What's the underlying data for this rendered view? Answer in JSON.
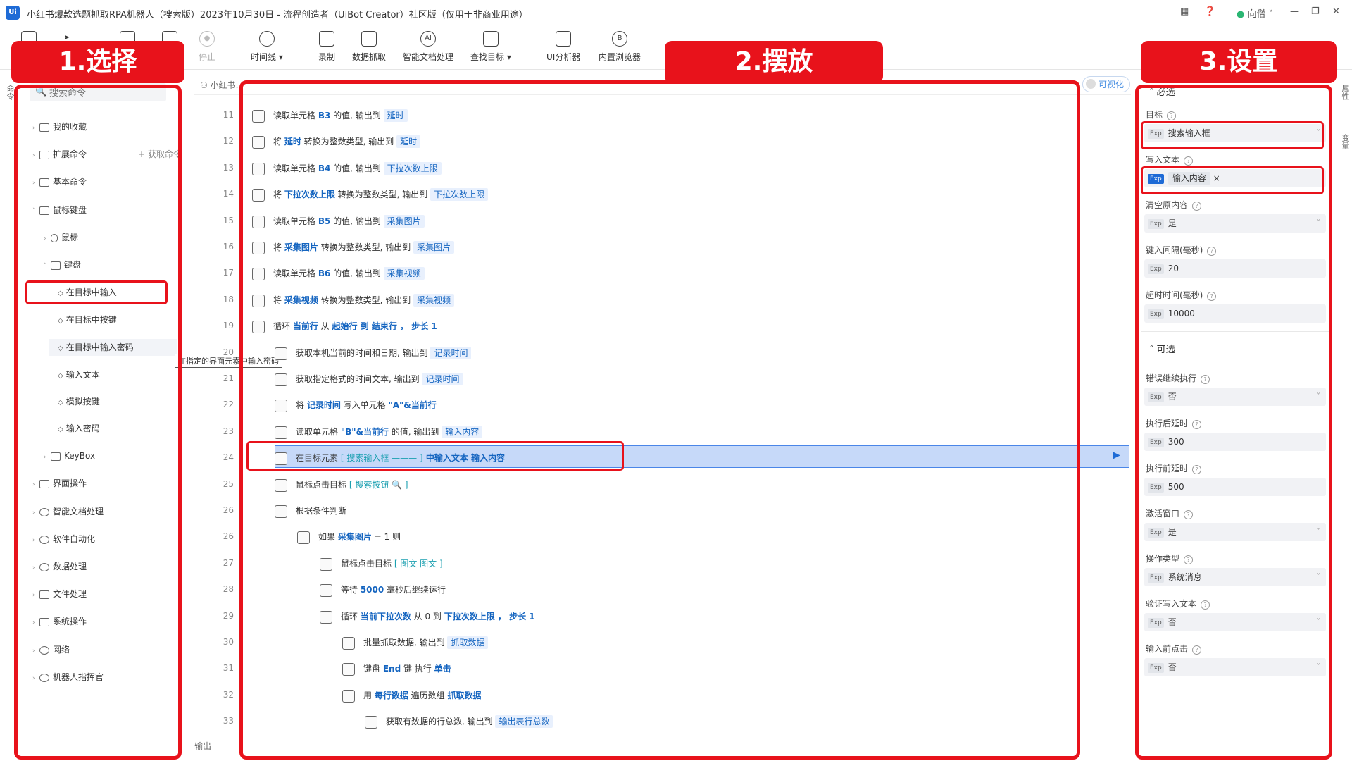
{
  "window": {
    "logo": "Ui",
    "title": "小红书爆款选题抓取RPA机器人（搜索版）2023年10月30日 - 流程创造者（UiBot Creator）社区版（仅用于非商业用途）",
    "user": "向僧"
  },
  "toolbar": {
    "items": [
      "停止",
      "时间线",
      "录制",
      "数据抓取",
      "智能文档处理",
      "查找目标",
      "UI分析器",
      "内置浏览器"
    ]
  },
  "annotations": {
    "select": "1.选择",
    "place": "2.摆放",
    "settings": "3.设置"
  },
  "left_panel": {
    "search_placeholder": "搜索命令",
    "add_command": "+ 获取命令",
    "tree": [
      "我的收藏",
      "扩展命令",
      "基本命令",
      "鼠标键盘",
      "鼠标",
      "键盘",
      "在目标中输入",
      "在目标中按键",
      "在目标中输入密码",
      "输入文本",
      "模拟按键",
      "输入密码",
      "KeyBox",
      "界面操作",
      "智能文档处理",
      "软件自动化",
      "数据处理",
      "文件处理",
      "系统操作",
      "网络",
      "机器人指挥官"
    ],
    "tooltip": "在指定的界面元素中输入密码"
  },
  "editor": {
    "tab": "小红书...",
    "viz_toggle": "可视化",
    "output": "输出",
    "line_numbers": [
      "11",
      "12",
      "13",
      "14",
      "15",
      "16",
      "17",
      "18",
      "19",
      "20",
      "21",
      "22",
      "23",
      "24",
      "25",
      "26",
      "26",
      "27",
      "28",
      "29",
      "30",
      "31",
      "32",
      "33"
    ],
    "rows": [
      {
        "p1": "读取单元格 ",
        "k1": "B3",
        "p2": " 的值, 输出到 ",
        "t1": "延时"
      },
      {
        "p1": "将 ",
        "k1": "延时",
        "p2": " 转换为整数类型, 输出到 ",
        "t1": "延时"
      },
      {
        "p1": "读取单元格 ",
        "k1": "B4",
        "p2": " 的值, 输出到 ",
        "t1": "下拉次数上限"
      },
      {
        "p1": "将 ",
        "k1": "下拉次数上限",
        "p2": " 转换为整数类型, 输出到 ",
        "t1": "下拉次数上限"
      },
      {
        "p1": "读取单元格 ",
        "k1": "B5",
        "p2": " 的值, 输出到 ",
        "t1": "采集图片"
      },
      {
        "p1": "将 ",
        "k1": "采集图片",
        "p2": " 转换为整数类型, 输出到 ",
        "t1": "采集图片"
      },
      {
        "p1": "读取单元格 ",
        "k1": "B6",
        "p2": " 的值, 输出到 ",
        "t1": "采集视频"
      },
      {
        "p1": "将 ",
        "k1": "采集视频",
        "p2": " 转换为整数类型, 输出到 ",
        "t1": "采集视频"
      },
      {
        "p1": "循环 ",
        "k1": "当前行",
        "p2": " 从 ",
        "t1": "",
        "extra": "起始行 到 结束行 ， 步长 1"
      },
      {
        "p1": "获取本机当前的时间和日期, 输出到 ",
        "k1": "",
        "p2": "",
        "t1": "记录时间"
      },
      {
        "p1": "获取指定格式的时间文本, 输出到 ",
        "k1": "",
        "p2": "",
        "t1": "记录时间"
      },
      {
        "p1": "将 ",
        "k1": "记录时间",
        "p2": " 写入单元格 ",
        "t1": "",
        "extra": "\"A\"&当前行"
      },
      {
        "p1": "读取单元格 ",
        "k1": "\"B\"&当前行",
        "p2": " 的值, 输出到 ",
        "t1": "输入内容"
      },
      {
        "p1": "在目标元素 ",
        "k1": "",
        "p2": "",
        "t1": "",
        "sq": "[ 搜索输入框 ——— ]",
        "extra": " 中输入文本 ",
        "k2": "输入内容"
      },
      {
        "p1": "鼠标点击目标 ",
        "k1": "",
        "p2": "",
        "t1": "",
        "sq": "[ 搜索按钮  🔍  ]"
      },
      {
        "p1": "根据条件判断",
        "k1": "",
        "p2": "",
        "t1": ""
      },
      {
        "p1": "如果 ",
        "k1": "采集图片",
        "p2": " = 1 则",
        "t1": ""
      },
      {
        "p1": "鼠标点击目标 ",
        "k1": "",
        "p2": "",
        "t1": "",
        "sq": "[ 图文  图文  ]"
      },
      {
        "p1": "等待 ",
        "k1": "5000",
        "p2": " 毫秒后继续运行",
        "t1": ""
      },
      {
        "p1": "循环 ",
        "k1": "当前下拉次数",
        "p2": " 从 0 到 ",
        "t1": "",
        "extra": "下拉次数上限 ， 步长 1"
      },
      {
        "p1": "批量抓取数据, 输出到 ",
        "k1": "",
        "p2": "",
        "t1": "抓取数据"
      },
      {
        "p1": "键盘 ",
        "k1": "End",
        "p2": " 键 执行 ",
        "t1": "",
        "k2": "单击"
      },
      {
        "p1": "用 ",
        "k1": "每行数据",
        "p2": " 遍历数组 ",
        "t1": "",
        "k2": "抓取数据"
      },
      {
        "p1": "获取有数据的行总数, 输出到 ",
        "k1": "",
        "p2": "",
        "t1": "输出表行总数"
      }
    ]
  },
  "right_panel": {
    "required": "必选",
    "optional": "可选",
    "exp": "Exp",
    "props": [
      {
        "label": "目标",
        "value": "搜索输入框"
      },
      {
        "label": "写入文本",
        "value": "输入内容"
      },
      {
        "label": "清空原内容",
        "value": "是"
      },
      {
        "label": "键入间隔(毫秒)",
        "value": "20"
      },
      {
        "label": "超时时间(毫秒)",
        "value": "10000"
      },
      {
        "label": "错误继续执行",
        "value": "否"
      },
      {
        "label": "执行后延时",
        "value": "300"
      },
      {
        "label": "执行前延时",
        "value": "500"
      },
      {
        "label": "激活窗口",
        "value": "是"
      },
      {
        "label": "操作类型",
        "value": "系统消息"
      },
      {
        "label": "验证写入文本",
        "value": "否"
      },
      {
        "label": "输入前点击",
        "value": "否"
      }
    ],
    "side_tabs": [
      "属性",
      "变量"
    ]
  }
}
